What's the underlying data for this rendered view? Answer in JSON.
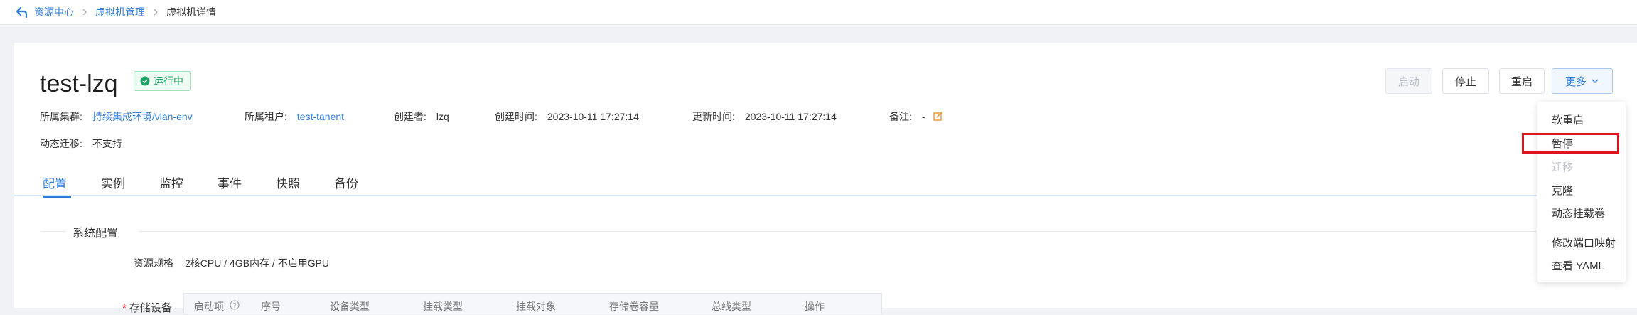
{
  "breadcrumb": {
    "items": [
      "资源中心",
      "虚拟机管理"
    ],
    "current": "虚拟机详情"
  },
  "vm": {
    "name": "test-lzq",
    "status": "运行中"
  },
  "actions": {
    "start": "启动",
    "stop": "停止",
    "restart": "重启",
    "more": "更多"
  },
  "meta": {
    "cluster_label": "所属集群:",
    "cluster_value": "持续集成环境/vlan-env",
    "tenant_label": "所属租户:",
    "tenant_value": "test-tanent",
    "creator_label": "创建者:",
    "creator_value": "lzq",
    "created_label": "创建时间:",
    "created_value": "2023-10-11 17:27:14",
    "updated_label": "更新时间:",
    "updated_value": "2023-10-11 17:27:14",
    "note_label": "备注:",
    "note_value": "-",
    "migration_label": "动态迁移:",
    "migration_value": "不支持"
  },
  "tabs": [
    "配置",
    "实例",
    "监控",
    "事件",
    "快照",
    "备份"
  ],
  "active_tab": "配置",
  "config": {
    "section_title": "系统配置",
    "spec_label": "资源规格",
    "spec_value": "2核CPU / 4GB内存 / 不启用GPU",
    "storage_label": "存储设备",
    "storage_columns": [
      "启动项",
      "序号",
      "设备类型",
      "挂载类型",
      "挂载对象",
      "存储卷容量",
      "总线类型",
      "操作"
    ]
  },
  "more_menu": [
    "软重启",
    "暂停",
    "迁移",
    "克隆",
    "动态挂载卷",
    "修改端口映射",
    "查看 YAML"
  ],
  "colors": {
    "link": "#2f7bdc",
    "running": "#19a463",
    "highlight": "#e0141e"
  }
}
